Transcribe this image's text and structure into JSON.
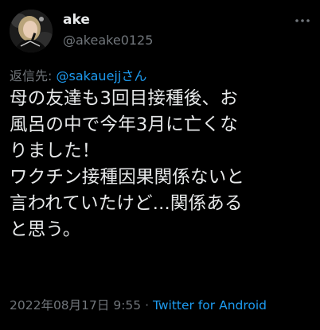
{
  "author": {
    "display_name": "ake",
    "handle": "@akeake0125",
    "avatar_icon": "user-avatar"
  },
  "reply": {
    "prefix": "返信先:",
    "mention": "@sakauejj",
    "suffix": "さん"
  },
  "tweet": {
    "lines": [
      "母の友達も3回目接種後、お",
      "風呂の中で今年3月に亡くな",
      "りました！",
      "ワクチン接種因果関係ないと",
      "言われていたけど...関係ある",
      "と思う。"
    ]
  },
  "meta": {
    "date": "2022年08月17日",
    "time": "9:55",
    "separator": "·",
    "source": "Twitter for Android"
  },
  "colors": {
    "background": "#000000",
    "text": "#e7e9ea",
    "secondary": "#71767b",
    "accent": "#1d9bf0"
  }
}
